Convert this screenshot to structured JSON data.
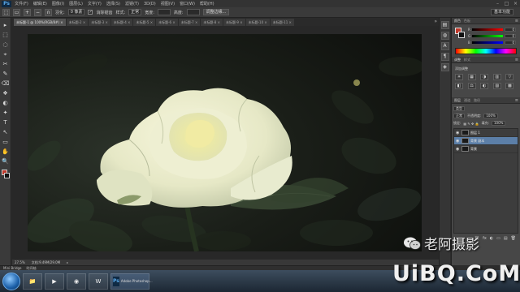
{
  "menubar": {
    "app_logo": "Ps",
    "items": [
      "文件(F)",
      "编辑(E)",
      "图像(I)",
      "图层(L)",
      "文字(Y)",
      "选择(S)",
      "滤镜(T)",
      "3D(D)",
      "视图(V)",
      "窗口(W)",
      "帮助(H)"
    ],
    "window_controls": [
      "–",
      "□",
      "×"
    ]
  },
  "optionsbar": {
    "feather_label": "羽化:",
    "feather_value": "0 像素",
    "antialias_label": "消除锯齿",
    "style_label": "样式:",
    "style_value": "正常",
    "width_label": "宽度:",
    "height_label": "高度:",
    "refine_button": "调整边缘...",
    "workspace": "基本功能"
  },
  "tools": [
    "▸",
    "⬚",
    "◌",
    "⌖",
    "✂",
    "✎",
    "⌫",
    "❖",
    "◐",
    "✦",
    "T",
    "↖",
    "▭",
    "✋",
    "🔍"
  ],
  "document_tabs": [
    {
      "label": "未标题-1 @ 100%(RGB/8#) ×",
      "active": true
    },
    {
      "label": "未标题-2 ×",
      "active": false
    },
    {
      "label": "未标题-3 ×",
      "active": false
    },
    {
      "label": "未标题-4 ×",
      "active": false
    },
    {
      "label": "未标题-5 ×",
      "active": false
    },
    {
      "label": "未标题-6 ×",
      "active": false
    },
    {
      "label": "未标题-7 ×",
      "active": false
    },
    {
      "label": "未标题-8 ×",
      "active": false
    },
    {
      "label": "未标题-9 ×",
      "active": false
    },
    {
      "label": "未标题-10 ×",
      "active": false
    },
    {
      "label": "未标题-11 ×",
      "active": false
    }
  ],
  "tabbar_more": "»",
  "statusbar": {
    "zoom": "27.5%",
    "doc_info": "文档:9.49M/29.0M",
    "arrow": "▸"
  },
  "minibridge": {
    "items": [
      "Mini Bridge",
      "时间轴"
    ]
  },
  "panel_icons": [
    "▤",
    "◍",
    "A",
    "¶",
    "◈"
  ],
  "color_panel": {
    "tab_color": "颜色",
    "tab_swatches": "色板",
    "menu": "≡",
    "sliders": [
      {
        "label": "R",
        "value": "0"
      },
      {
        "label": "G",
        "value": "0"
      },
      {
        "label": "B",
        "value": "0"
      }
    ],
    "fg_color": "#c0392b",
    "bg_color": "#111111"
  },
  "adjustments_panel": {
    "tab_adjust": "调整",
    "tab_styles": "样式",
    "menu": "≡",
    "title": "添加调整",
    "icons": [
      "☀",
      "▦",
      "◑",
      "▥",
      "▽",
      "◧",
      "⚖",
      "◐",
      "▨",
      "▩"
    ]
  },
  "layers_panel": {
    "tab_layers": "图层",
    "tab_channels": "通道",
    "tab_paths": "路径",
    "menu": "≡",
    "kind_label": "类型",
    "blend_mode": "正常",
    "opacity_label": "不透明度:",
    "opacity_value": "100%",
    "lock_label": "锁定:",
    "fill_label": "填充:",
    "fill_value": "100%",
    "layers": [
      {
        "name": "图层 1",
        "selected": false,
        "thumb": "dark"
      },
      {
        "name": "背景 副本",
        "selected": true,
        "thumb": "dark"
      },
      {
        "name": "背景",
        "selected": false,
        "thumb": "dark"
      }
    ],
    "footer_icons": [
      "⛓",
      "fx",
      "◐",
      "▭",
      "▤",
      "🗑"
    ]
  },
  "taskbar": {
    "buttons": [
      "📁",
      "▶",
      "◉",
      "W"
    ],
    "ps_label": "Adobe Photoshop...",
    "ps_logo": "Ps"
  },
  "watermark": {
    "cn_text": "老阿摄影",
    "site_text": "UiBQ.CoM"
  }
}
